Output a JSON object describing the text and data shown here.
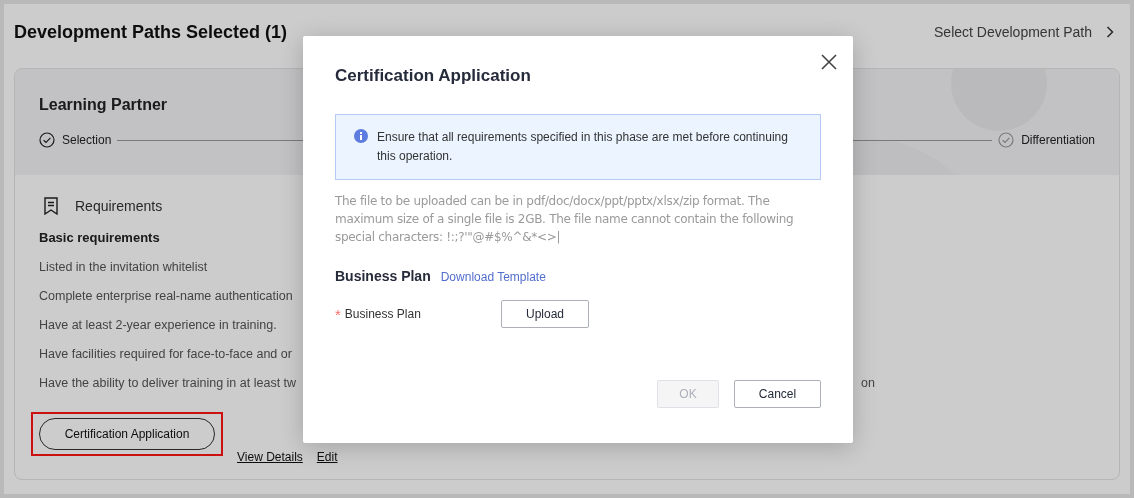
{
  "page": {
    "title": "Development Paths Selected (1)",
    "select_link": "Select Development Path"
  },
  "path_card": {
    "title": "Learning Partner",
    "steps": [
      {
        "label": "Selection",
        "done": true
      },
      {
        "label": "Differentiation",
        "done": false
      }
    ],
    "requirements_title": "Requirements",
    "basic_title": "Basic requirements",
    "requirements": [
      {
        "text": "Listed in the invitation whitelist"
      },
      {
        "text": "Complete enterprise real-name authentication"
      },
      {
        "text": "Have at least 2-year experience in training."
      },
      {
        "text": "Have facilities required for face-to-face and or"
      },
      {
        "text": "Have the ability to deliver training in at least tw",
        "tail": "on"
      }
    ],
    "apply_button": {
      "label": "Certification Application",
      "highlighted": true
    },
    "links": [
      "View Details",
      "Edit"
    ]
  },
  "dialog": {
    "title": "Certification Application",
    "notice": "Ensure that all requirements specified in this phase are met before continuing this operation.",
    "hint": "The file to be uploaded can be in pdf/doc/docx/ppt/pptx/xlsx/zip format. The maximum size of a single file is 2GB. The file name cannot contain the following special characters: !:;?'\"@#$%^&*<>|",
    "section_title": "Business Plan",
    "template_link": "Download Template",
    "field": {
      "required_mark": "*",
      "label": "Business Plan",
      "required": true,
      "button": "Upload"
    },
    "buttons": [
      {
        "label": "OK",
        "disabled": true
      },
      {
        "label": "Cancel",
        "disabled": false
      }
    ]
  }
}
